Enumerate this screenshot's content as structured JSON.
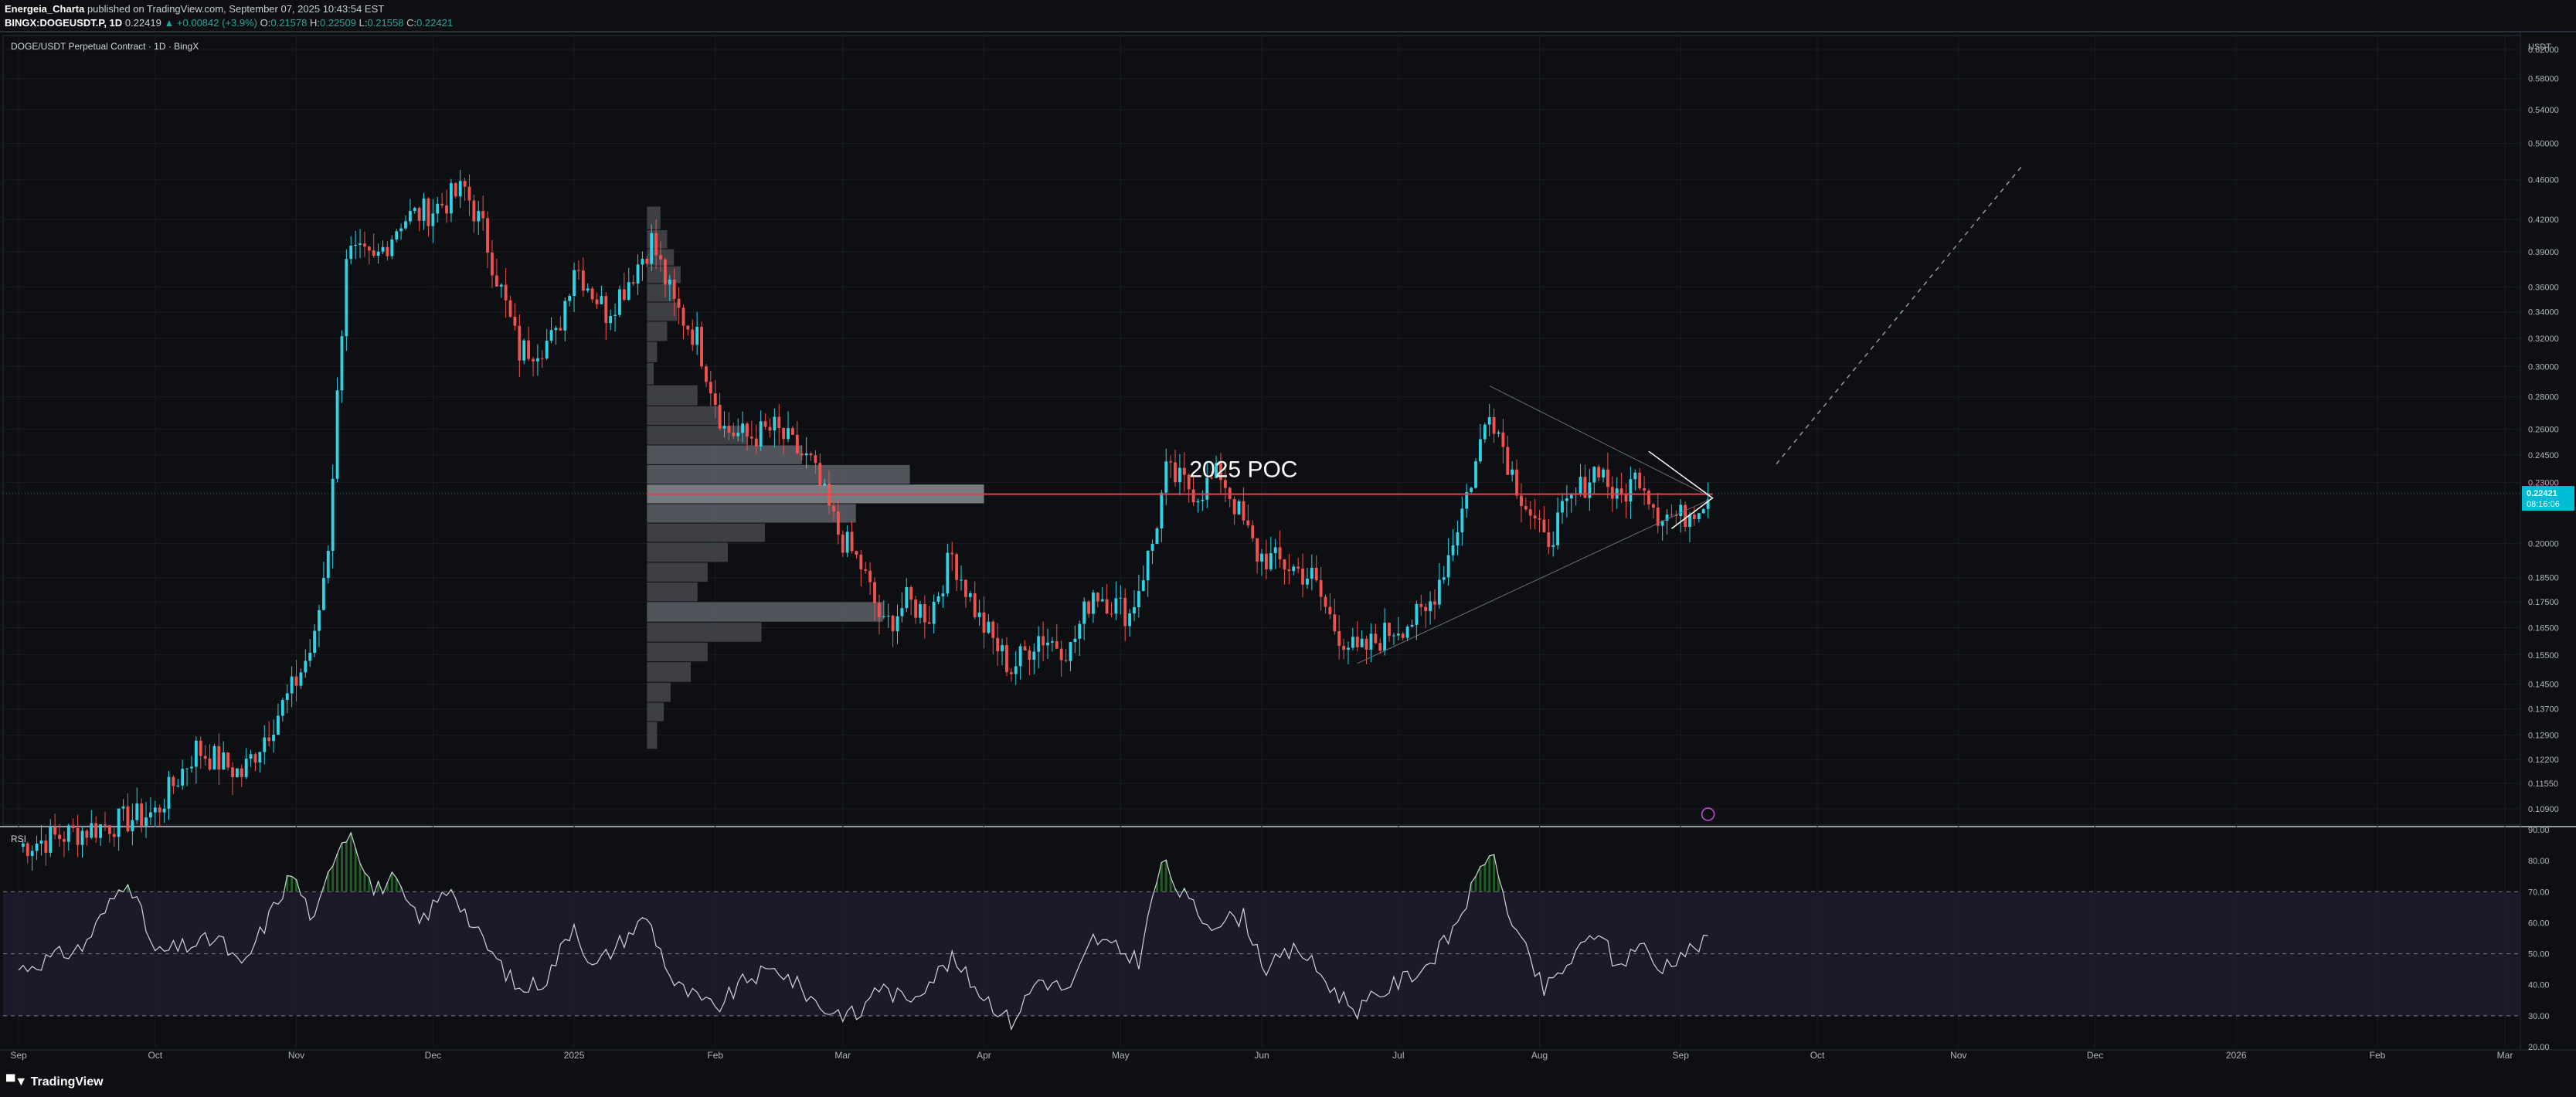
{
  "header": {
    "author": "Energeia_Charta",
    "published": "published on TradingView.com, September 07, 2025 10:43:54 EST",
    "symbol": "BINGX:DOGEUSDT.P, 1D",
    "last": "0.22419",
    "change": "▲ +0.00842 (+3.9%)",
    "o_label": "O:",
    "o": "0.21578",
    "h_label": "H:",
    "h": "0.22509",
    "l_label": "L:",
    "l": "0.21558",
    "c_label": "C:",
    "c": "0.22421"
  },
  "pane_title": "DOGE/USDT Perpetual Contract · 1D · BingX",
  "rsi_label": "RSI",
  "currency": "USDT",
  "annotation": "2025 POC",
  "price_badge": {
    "price": "0.22421",
    "countdown": "08:16:06"
  },
  "footer_logo": "TradingView",
  "colors": {
    "up": "#26a69a",
    "up_bright": "#2fd3e6",
    "down": "#ef5350",
    "poc": "#f23645",
    "rsi": "#d1d4dc",
    "badge": "#00bcd4"
  },
  "chart_data": [
    {
      "type": "candlestick",
      "scale": "log",
      "ylim": [
        0.105,
        0.64
      ],
      "x_ticks": [
        "Sep",
        "Oct",
        "Nov",
        "Dec",
        "2025",
        "Feb",
        "Mar",
        "Apr",
        "May",
        "Jun",
        "Jul",
        "Aug",
        "Sep",
        "Oct",
        "Nov",
        "Dec",
        "2026",
        "Feb",
        "Mar"
      ],
      "y_ticks": [
        "0.62000",
        "0.58000",
        "0.54000",
        "0.50000",
        "0.46000",
        "0.42000",
        "0.39000",
        "0.36000",
        "0.34000",
        "0.32000",
        "0.30000",
        "0.28000",
        "0.26000",
        "0.24500",
        "0.23000",
        "0.20000",
        "0.18500",
        "0.17500",
        "0.16500",
        "0.15500",
        "0.14500",
        "0.13700",
        "0.12900",
        "0.12200",
        "0.11550",
        "0.10900"
      ],
      "price_path": [
        [
          "2024-09-01",
          0.1
        ],
        [
          "2024-10-01",
          0.108
        ],
        [
          "2024-10-10",
          0.125
        ],
        [
          "2024-10-20",
          0.118
        ],
        [
          "2024-10-31",
          0.143
        ],
        [
          "2024-11-05",
          0.16
        ],
        [
          "2024-11-08",
          0.2
        ],
        [
          "2024-11-12",
          0.39
        ],
        [
          "2024-11-18",
          0.38
        ],
        [
          "2024-11-24",
          0.42
        ],
        [
          "2024-12-01",
          0.43
        ],
        [
          "2024-12-08",
          0.45
        ],
        [
          "2024-12-12",
          0.41
        ],
        [
          "2024-12-20",
          0.31
        ],
        [
          "2024-12-28",
          0.32
        ],
        [
          "2025-01-01",
          0.38
        ],
        [
          "2025-01-08",
          0.34
        ],
        [
          "2025-01-12",
          0.36
        ],
        [
          "2025-01-18",
          0.4
        ],
        [
          "2025-01-23",
          0.345
        ],
        [
          "2025-01-28",
          0.32
        ],
        [
          "2025-02-03",
          0.26
        ],
        [
          "2025-02-08",
          0.255
        ],
        [
          "2025-02-14",
          0.26
        ],
        [
          "2025-02-22",
          0.24
        ],
        [
          "2025-02-28",
          0.205
        ],
        [
          "2025-03-05",
          0.19
        ],
        [
          "2025-03-10",
          0.165
        ],
        [
          "2025-03-15",
          0.175
        ],
        [
          "2025-03-20",
          0.17
        ],
        [
          "2025-03-25",
          0.195
        ],
        [
          "2025-03-31",
          0.168
        ],
        [
          "2025-04-07",
          0.15
        ],
        [
          "2025-04-13",
          0.162
        ],
        [
          "2025-04-20",
          0.157
        ],
        [
          "2025-04-25",
          0.18
        ],
        [
          "2025-05-03",
          0.17
        ],
        [
          "2025-05-08",
          0.2
        ],
        [
          "2025-05-11",
          0.235
        ],
        [
          "2025-05-18",
          0.225
        ],
        [
          "2025-05-23",
          0.235
        ],
        [
          "2025-05-31",
          0.195
        ],
        [
          "2025-06-07",
          0.19
        ],
        [
          "2025-06-12",
          0.185
        ],
        [
          "2025-06-17",
          0.165
        ],
        [
          "2025-06-22",
          0.155
        ],
        [
          "2025-06-30",
          0.165
        ],
        [
          "2025-07-07",
          0.17
        ],
        [
          "2025-07-12",
          0.195
        ],
        [
          "2025-07-18",
          0.24
        ],
        [
          "2025-07-21",
          0.275
        ],
        [
          "2025-07-26",
          0.235
        ],
        [
          "2025-08-02",
          0.2
        ],
        [
          "2025-08-08",
          0.22
        ],
        [
          "2025-08-14",
          0.24
        ],
        [
          "2025-08-18",
          0.22
        ],
        [
          "2025-08-23",
          0.235
        ],
        [
          "2025-08-27",
          0.215
        ],
        [
          "2025-09-01",
          0.212
        ],
        [
          "2025-09-07",
          0.224
        ]
      ],
      "poc_level": 0.224,
      "volume_profile_price_levels": [
        0.42,
        0.4,
        0.385,
        0.37,
        0.355,
        0.34,
        0.325,
        0.31,
        0.295,
        0.28,
        0.268,
        0.256,
        0.245,
        0.234,
        0.224,
        0.214,
        0.205,
        0.196,
        0.187,
        0.179,
        0.171,
        0.163,
        0.156,
        0.149,
        0.142,
        0.136,
        0.13
      ],
      "volume_profile_values": [
        4,
        6,
        8,
        10,
        8,
        9,
        6,
        3,
        2,
        15,
        22,
        30,
        46,
        78,
        100,
        62,
        35,
        24,
        18,
        15,
        70,
        34,
        18,
        13,
        7,
        5,
        3
      ]
    },
    {
      "type": "line",
      "name": "RSI",
      "ylim": [
        20,
        90
      ],
      "y_ticks": [
        "90.00",
        "80.00",
        "70.00",
        "60.00",
        "50.00",
        "40.00",
        "30.00",
        "20.00"
      ],
      "bands": [
        30,
        50,
        70
      ],
      "path": [
        [
          "2024-09-01",
          45
        ],
        [
          "2024-09-15",
          52
        ],
        [
          "2024-09-25",
          75
        ],
        [
          "2024-10-01",
          50
        ],
        [
          "2024-10-15",
          55
        ],
        [
          "2024-10-20",
          45
        ],
        [
          "2024-10-31",
          76
        ],
        [
          "2024-11-05",
          60
        ],
        [
          "2024-11-10",
          85
        ],
        [
          "2024-11-13",
          90
        ],
        [
          "2024-11-18",
          70
        ],
        [
          "2024-11-22",
          74
        ],
        [
          "2024-11-28",
          60
        ],
        [
          "2024-12-05",
          72
        ],
        [
          "2024-12-10",
          58
        ],
        [
          "2024-12-20",
          38
        ],
        [
          "2024-12-26",
          42
        ],
        [
          "2025-01-01",
          60
        ],
        [
          "2025-01-05",
          45
        ],
        [
          "2025-01-12",
          55
        ],
        [
          "2025-01-17",
          62
        ],
        [
          "2025-01-23",
          40
        ],
        [
          "2025-02-01",
          32
        ],
        [
          "2025-02-08",
          42
        ],
        [
          "2025-02-15",
          45
        ],
        [
          "2025-02-25",
          32
        ],
        [
          "2025-03-05",
          30
        ],
        [
          "2025-03-08",
          40
        ],
        [
          "2025-03-15",
          35
        ],
        [
          "2025-03-25",
          48
        ],
        [
          "2025-03-31",
          38
        ],
        [
          "2025-04-07",
          28
        ],
        [
          "2025-04-13",
          42
        ],
        [
          "2025-04-20",
          38
        ],
        [
          "2025-04-25",
          55
        ],
        [
          "2025-05-05",
          48
        ],
        [
          "2025-05-10",
          80
        ],
        [
          "2025-05-14",
          70
        ],
        [
          "2025-05-20",
          60
        ],
        [
          "2025-05-28",
          62
        ],
        [
          "2025-06-02",
          45
        ],
        [
          "2025-06-09",
          52
        ],
        [
          "2025-06-17",
          38
        ],
        [
          "2025-06-22",
          32
        ],
        [
          "2025-06-30",
          40
        ],
        [
          "2025-07-07",
          46
        ],
        [
          "2025-07-12",
          55
        ],
        [
          "2025-07-18",
          73
        ],
        [
          "2025-07-21",
          84
        ],
        [
          "2025-07-26",
          60
        ],
        [
          "2025-08-02",
          38
        ],
        [
          "2025-08-08",
          48
        ],
        [
          "2025-08-14",
          58
        ],
        [
          "2025-08-18",
          45
        ],
        [
          "2025-08-23",
          54
        ],
        [
          "2025-08-27",
          45
        ],
        [
          "2025-09-01",
          50
        ],
        [
          "2025-09-07",
          54
        ]
      ]
    }
  ]
}
